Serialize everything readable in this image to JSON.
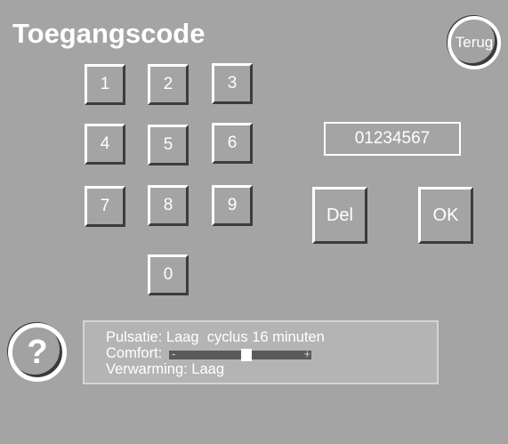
{
  "header": {
    "title": "Toegangscode",
    "back_label": "Terug"
  },
  "keypad": {
    "keys": [
      "1",
      "2",
      "3",
      "4",
      "5",
      "6",
      "7",
      "8",
      "9",
      "0"
    ]
  },
  "code": {
    "value": "01234567"
  },
  "actions": {
    "delete_label": "Del",
    "ok_label": "OK"
  },
  "help": {
    "label": "?"
  },
  "status": {
    "pulsation_label": "Pulsatie:",
    "pulsation_value": "Laag  cyclus 16 minuten",
    "comfort_label": "Comfort:",
    "comfort_level": 0.55,
    "comfort_minus": "-",
    "comfort_plus": "+",
    "heating_label": "Verwarming:",
    "heating_value": "Laag"
  },
  "colors": {
    "background": "#a4a4a4",
    "text": "#ffffff",
    "shadow": "#3c3c3c"
  }
}
